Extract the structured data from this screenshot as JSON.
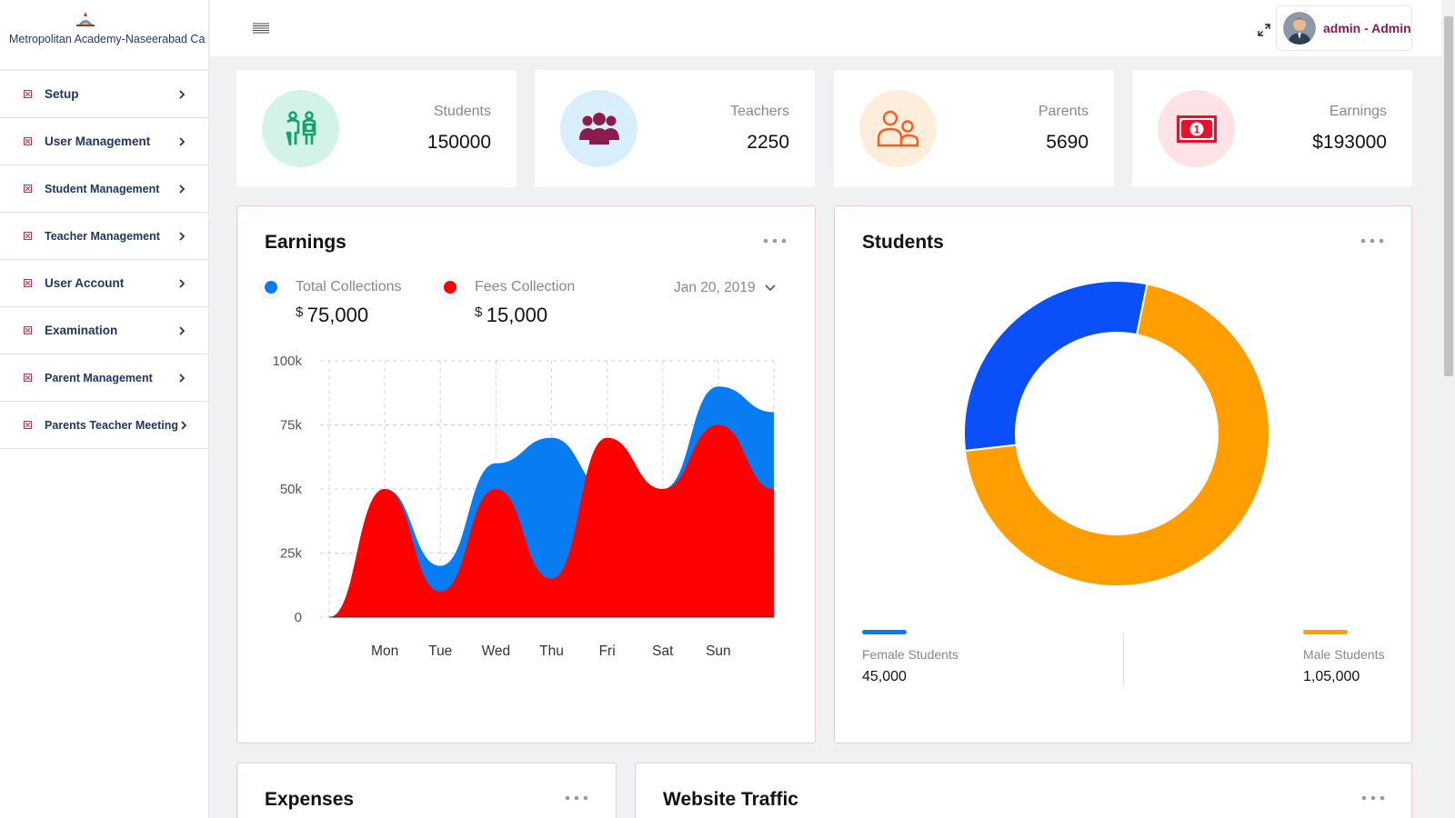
{
  "brand": {
    "name": "Metropolitan Academy-Naseerabad Ca"
  },
  "sidebar": {
    "items": [
      {
        "label": "Setup"
      },
      {
        "label": "User Management"
      },
      {
        "label": "Student Management"
      },
      {
        "label": "Teacher Management"
      },
      {
        "label": "User Account"
      },
      {
        "label": "Examination"
      },
      {
        "label": "Parent Management"
      },
      {
        "label": "Parents Teacher Meeting"
      }
    ]
  },
  "header": {
    "user_label": "admin - Admin"
  },
  "stats": [
    {
      "label": "Students",
      "value": "150000",
      "icon": "students-icon",
      "color": "#12a36b",
      "bg": "#d3f3e6"
    },
    {
      "label": "Teachers",
      "value": "2250",
      "icon": "teachers-icon",
      "color": "#8b1a4d",
      "bg": "#d8effb"
    },
    {
      "label": "Parents",
      "value": "5690",
      "icon": "parents-icon",
      "color": "#ff5a1f",
      "bg": "#fdeedb"
    },
    {
      "label": "Earnings",
      "value": "$193000",
      "icon": "money-icon",
      "color": "#e8112d",
      "bg": "#fde2e6"
    }
  ],
  "earnings_panel": {
    "title": "Earnings",
    "legend": [
      {
        "label": "Total Collections",
        "currency": "$",
        "amount": "75,000",
        "color": "#0a7cf2"
      },
      {
        "label": "Fees Collection",
        "currency": "$",
        "amount": "15,000",
        "color": "#ff0000"
      }
    ],
    "date": "Jan 20, 2019"
  },
  "students_panel": {
    "title": "Students",
    "female": {
      "label": "Female Students",
      "value": "45,000",
      "color": "#0a7cf2"
    },
    "male": {
      "label": "Male Students",
      "value": "1,05,000",
      "color": "#ff9e00"
    }
  },
  "expenses_panel": {
    "title": "Expenses"
  },
  "traffic_panel": {
    "title": "Website Traffic"
  },
  "chart_data": [
    {
      "type": "area",
      "title": "Earnings",
      "categories": [
        "Mon",
        "Tue",
        "Wed",
        "Thu",
        "Fri",
        "Sat",
        "Sun"
      ],
      "x": [
        0,
        1,
        2,
        3,
        4,
        5,
        6,
        7,
        8
      ],
      "ylim": [
        0,
        100000
      ],
      "yticks": [
        "0",
        "25k",
        "50k",
        "75k",
        "100k"
      ],
      "series": [
        {
          "name": "Total Collections",
          "color": "#0a7cf2",
          "values": [
            0,
            50000,
            20000,
            60000,
            70000,
            50000,
            50000,
            90000,
            80000
          ]
        },
        {
          "name": "Fees Collection",
          "color": "#ff0000",
          "values": [
            0,
            50000,
            10000,
            50000,
            15000,
            70000,
            50000,
            75000,
            50000
          ]
        }
      ],
      "grid": true
    },
    {
      "type": "pie",
      "title": "Students",
      "labels": [
        "Female Students",
        "Male Students"
      ],
      "values": [
        45000,
        105000
      ],
      "colors": [
        "#0a4ff7",
        "#ff9e00"
      ]
    }
  ]
}
